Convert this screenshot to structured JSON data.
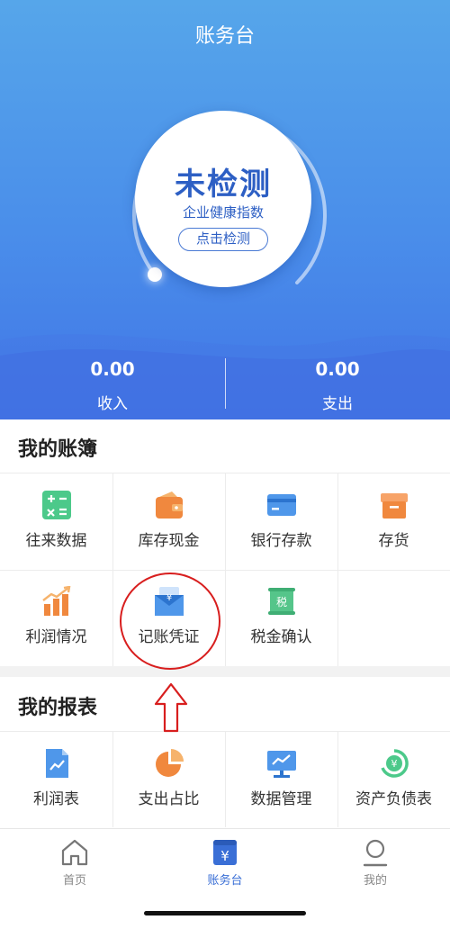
{
  "header": {
    "title": "账务台"
  },
  "health": {
    "status": "未检测",
    "subtitle": "企业健康指数",
    "check_label": "点击检测"
  },
  "stats": [
    {
      "value": "0.00",
      "label": "收入"
    },
    {
      "value": "0.00",
      "label": "支出"
    }
  ],
  "ledger": {
    "title": "我的账簿",
    "items": [
      {
        "label": "往来数据",
        "icon": "calculator-icon"
      },
      {
        "label": "库存现金",
        "icon": "wallet-icon"
      },
      {
        "label": "银行存款",
        "icon": "bank-card-icon"
      },
      {
        "label": "存货",
        "icon": "box-icon"
      },
      {
        "label": "利润情况",
        "icon": "bar-trend-icon"
      },
      {
        "label": "记账凭证",
        "icon": "voucher-icon"
      },
      {
        "label": "税金确认",
        "icon": "tax-scroll-icon"
      }
    ]
  },
  "reports": {
    "title": "我的报表",
    "items": [
      {
        "label": "利润表",
        "icon": "document-trend-icon"
      },
      {
        "label": "支出占比",
        "icon": "pie-chart-icon"
      },
      {
        "label": "数据管理",
        "icon": "monitor-chart-icon"
      },
      {
        "label": "资产负债表",
        "icon": "yuan-cycle-icon"
      }
    ]
  },
  "tabbar": {
    "items": [
      {
        "label": "首页",
        "icon": "home-icon"
      },
      {
        "label": "账务台",
        "icon": "ledger-yuan-icon",
        "active": true
      },
      {
        "label": "我的",
        "icon": "user-icon"
      }
    ]
  },
  "colors": {
    "primary": "#4a8eea",
    "accent_orange": "#f0883e",
    "accent_green": "#4cc98a",
    "annotation_red": "#d81e1e"
  }
}
